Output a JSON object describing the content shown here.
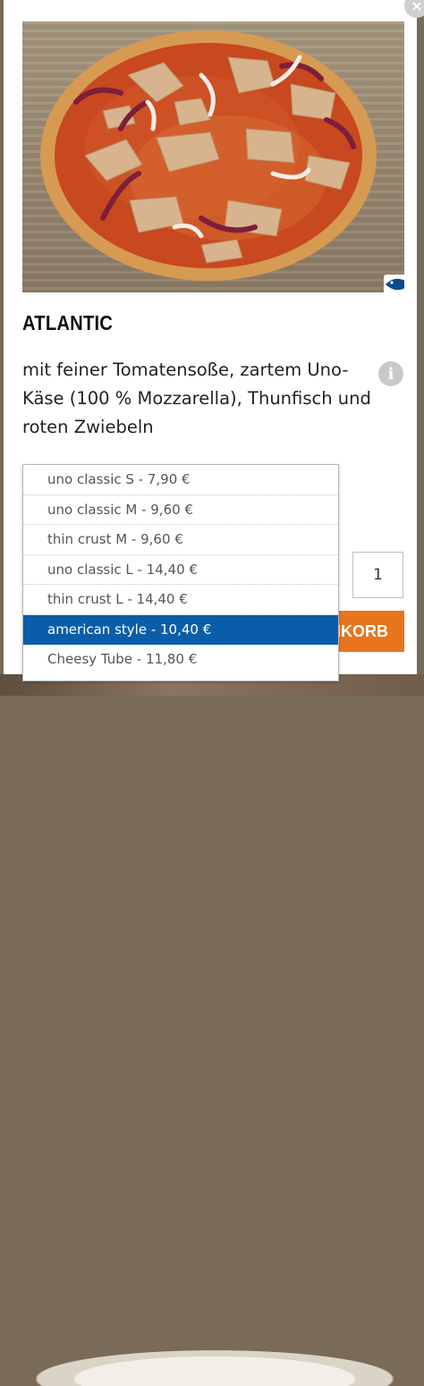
{
  "product": {
    "title": "ATLANTIC",
    "description": "mit feiner Tomatensoße, zartem Uno-Käse (100 % Mozzarella), Thunfisch und roten Zwiebeln",
    "badge_icon": "fish-icon",
    "info_icon": "info-icon"
  },
  "close_label": "×",
  "size_options": [
    "uno classic S - 7,90 €",
    "uno classic M - 9,60 €",
    "thin crust M - 9,60 €",
    "uno classic L - 14,40 €",
    "thin crust L - 14,40 €",
    "american style - 10,40 €",
    "Cheesy Tube - 11,80 €"
  ],
  "selected_option": "american style - 10,40 €",
  "quantity": "1",
  "cart_button_label": "NKORB",
  "colors": {
    "accent": "#e8741c",
    "selected_option": "#0a5da8"
  }
}
